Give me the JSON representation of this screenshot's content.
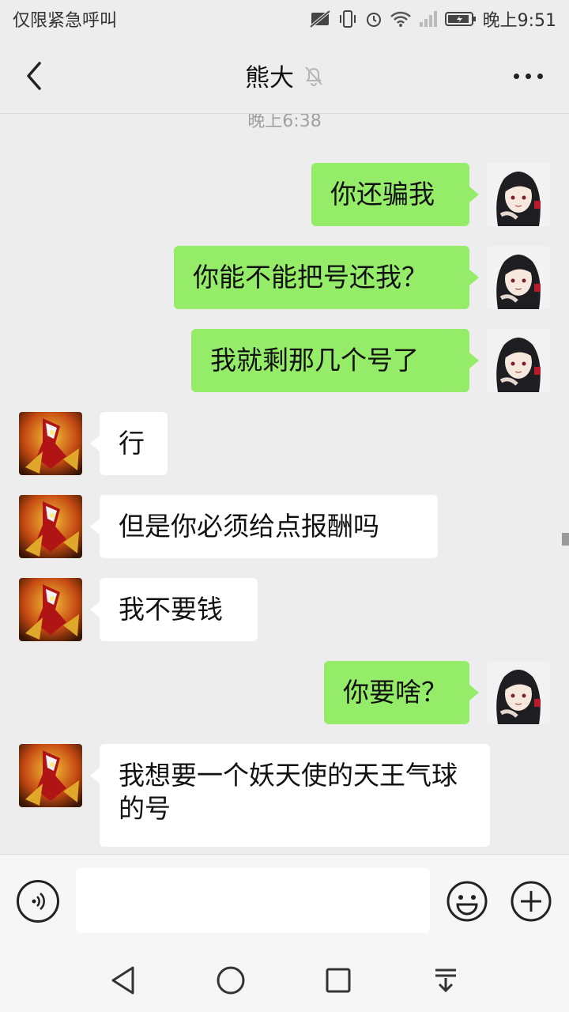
{
  "status_bar": {
    "carrier": "仅限紧急呼叫",
    "time": "晚上9:51"
  },
  "header": {
    "title": "熊大",
    "icons": {
      "back": "chevron-left-icon",
      "mute": "bell-off-icon",
      "more": "more-dots-icon"
    }
  },
  "chat": {
    "timestamp": "晚上6:38",
    "messages": [
      {
        "sender": "me",
        "text": "你还骗我"
      },
      {
        "sender": "me",
        "text": "你能不能把号还我？"
      },
      {
        "sender": "me",
        "text": "我就剩那几个号了"
      },
      {
        "sender": "them",
        "text": "行"
      },
      {
        "sender": "them",
        "text": "但是你必须给点报酬吗"
      },
      {
        "sender": "them",
        "text": "我不要钱"
      },
      {
        "sender": "me",
        "text": "你要啥？"
      },
      {
        "sender": "them",
        "text": "我想要一个妖天使的天王气球的号"
      }
    ]
  },
  "input_bar": {
    "placeholder": "",
    "icons": {
      "voice": "voice-icon",
      "emoji": "emoji-icon",
      "plus": "plus-icon"
    }
  },
  "colors": {
    "sent_bubble": "#95ec69",
    "received_bubble": "#ffffff",
    "background": "#ededed"
  }
}
